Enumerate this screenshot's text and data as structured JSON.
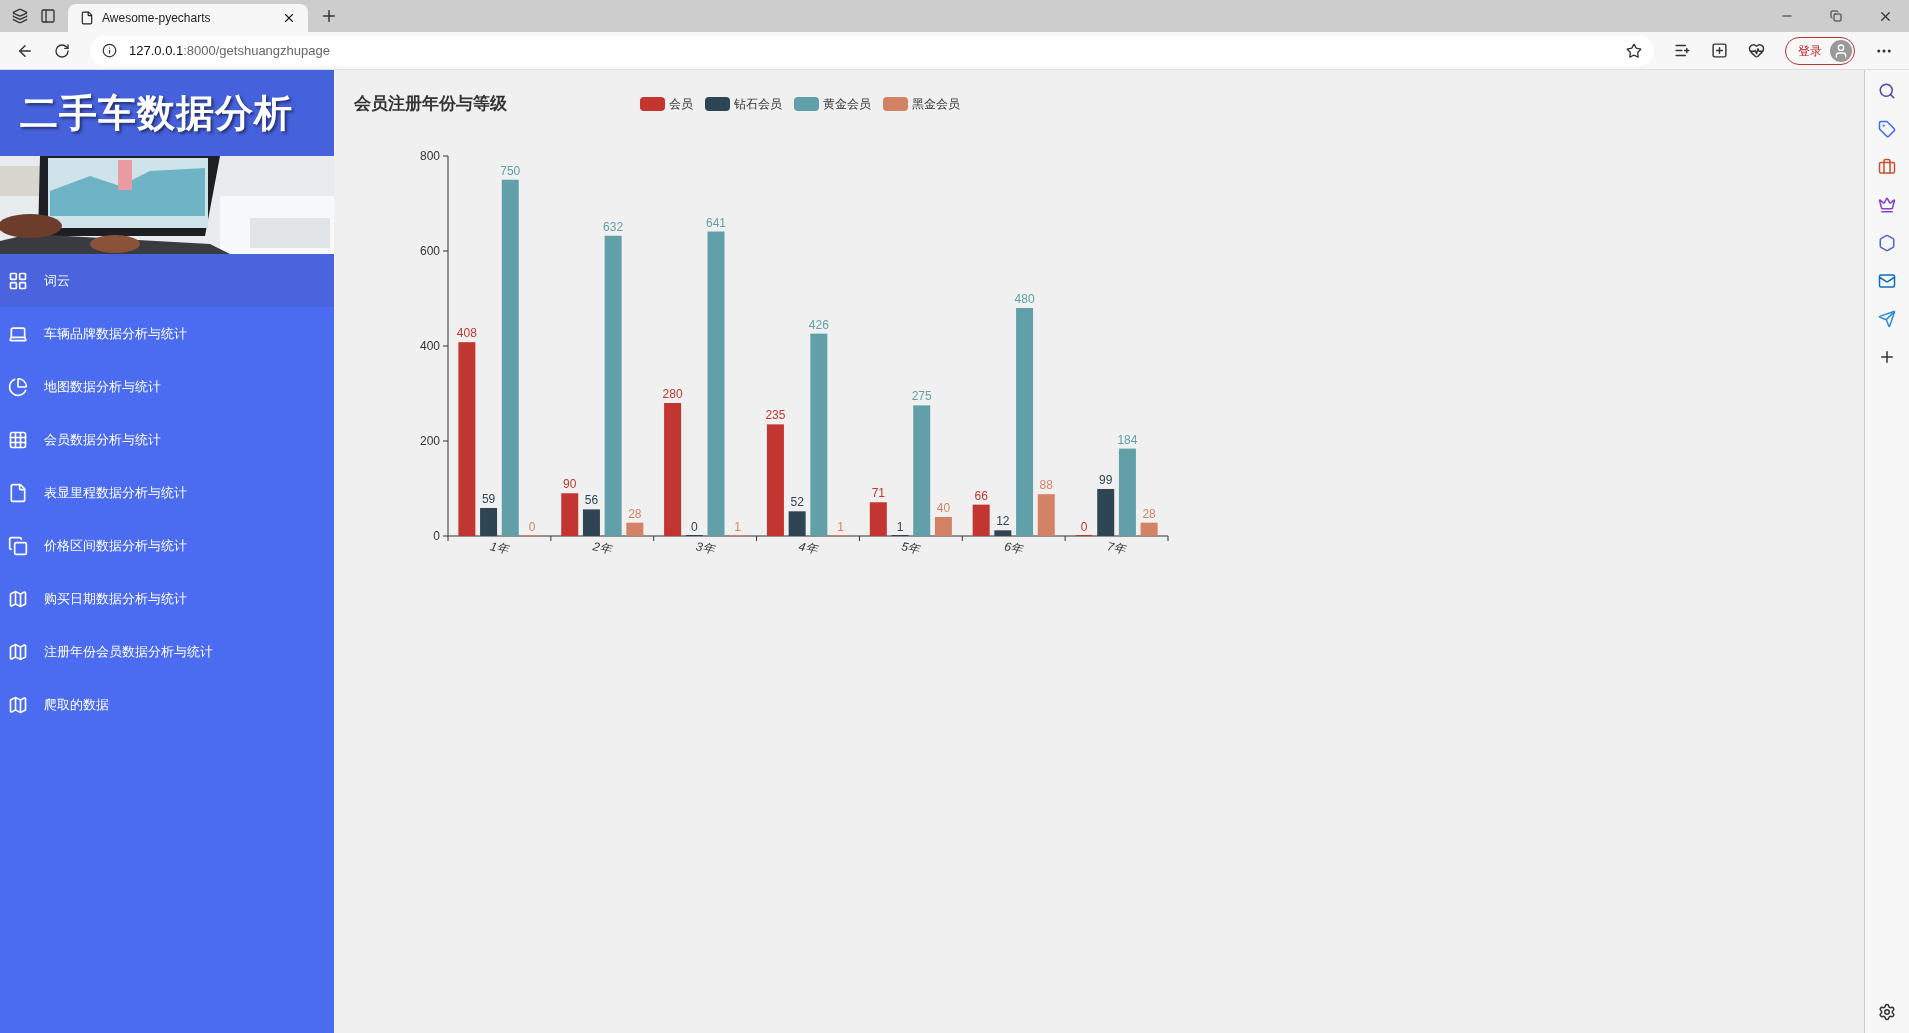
{
  "browser": {
    "tabs": [
      {
        "title": "Awesome-pyecharts",
        "selected": true
      }
    ],
    "address": {
      "host": "127.0.0.1",
      "path": ":8000/getshuangzhupage"
    },
    "login_button": "登录"
  },
  "sidebar": {
    "title": "二手车数据分析",
    "items": [
      {
        "label": "词云",
        "kind": "grid",
        "selected": true
      },
      {
        "label": "车辆品牌数据分析与统计",
        "kind": "laptop",
        "selected": false
      },
      {
        "label": "地图数据分析与统计",
        "kind": "pie",
        "selected": false
      },
      {
        "label": "会员数据分析与统计",
        "kind": "tiles",
        "selected": false
      },
      {
        "label": "表显里程数据分析与统计",
        "kind": "file",
        "selected": false
      },
      {
        "label": "价格区间数据分析与统计",
        "kind": "windows",
        "selected": false
      },
      {
        "label": "购买日期数据分析与统计",
        "kind": "map",
        "selected": false
      },
      {
        "label": "注册年份会员数据分析与统计",
        "kind": "map",
        "selected": false
      },
      {
        "label": "爬取的数据",
        "kind": "map",
        "selected": false
      }
    ]
  },
  "chart_data": {
    "type": "bar",
    "title": "会员注册年份与等级",
    "categories": [
      "1年",
      "2年",
      "3年",
      "4年",
      "5年",
      "6年",
      "7年"
    ],
    "series": [
      {
        "name": "会员",
        "color": "#c23531",
        "values": [
          408,
          90,
          280,
          235,
          71,
          66,
          0
        ]
      },
      {
        "name": "钻石会员",
        "color": "#2f4554",
        "values": [
          59,
          56,
          0,
          52,
          1,
          12,
          99
        ]
      },
      {
        "name": "黄金会员",
        "color": "#61a0a8",
        "values": [
          750,
          632,
          641,
          426,
          275,
          480,
          184
        ]
      },
      {
        "name": "黑金会员",
        "color": "#d48265",
        "values": [
          0,
          28,
          1,
          1,
          40,
          88,
          28
        ]
      }
    ],
    "ylim": [
      0,
      800
    ],
    "yticks": [
      0,
      200,
      400,
      600,
      800
    ],
    "data_labels": true
  }
}
